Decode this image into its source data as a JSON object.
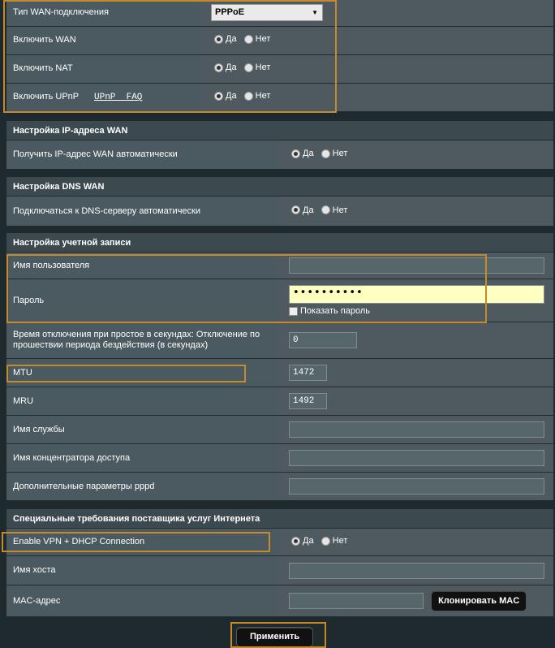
{
  "wan": {
    "type_label": "Тип WAN-подключения",
    "type_value": "PPPoE",
    "enable_wan_label": "Включить WAN",
    "enable_nat_label": "Включить NAT",
    "enable_upnp_label": "Включить UPnP",
    "upnp_faq": "UPnP  FAQ",
    "yes": "Да",
    "no": "Нет"
  },
  "ip_section": {
    "header": "Настройка IP-адреса WAN",
    "auto_label": "Получить IP-адрес WAN автоматически"
  },
  "dns_section": {
    "header": "Настройка DNS WAN",
    "auto_label": "Подключаться к DNS-серверу автоматически"
  },
  "account": {
    "header": "Настройка учетной записи",
    "username_label": "Имя пользователя",
    "username_value": "",
    "password_label": "Пароль",
    "password_value": "••••••••••",
    "show_password": "Показать пароль",
    "idle_label": "Время отключения при простое в секундах: Отключение по прошествии периода бездействия (в секундах)",
    "idle_value": "0",
    "mtu_label": "MTU",
    "mtu_value": "1472",
    "mru_label": "MRU",
    "mru_value": "1492",
    "service_label": "Имя службы",
    "service_value": "",
    "ac_label": "Имя концентратора доступа",
    "ac_value": "",
    "pppd_label": "Дополнительные параметры pppd",
    "pppd_value": ""
  },
  "isp": {
    "header": "Специальные требования поставщика услуг Интернета",
    "vpn_label": "Enable VPN + DHCP Connection",
    "host_label": "Имя хоста",
    "host_value": "",
    "mac_label": "MAC-адрес",
    "mac_value": "",
    "clone_mac": "Клонировать MAC"
  },
  "apply_label": "Применить",
  "colors": {
    "highlight": "#c68a2a",
    "background": "#1f2a2e",
    "row_label": "#4b5a60",
    "row_value": "#4e5a5f"
  }
}
